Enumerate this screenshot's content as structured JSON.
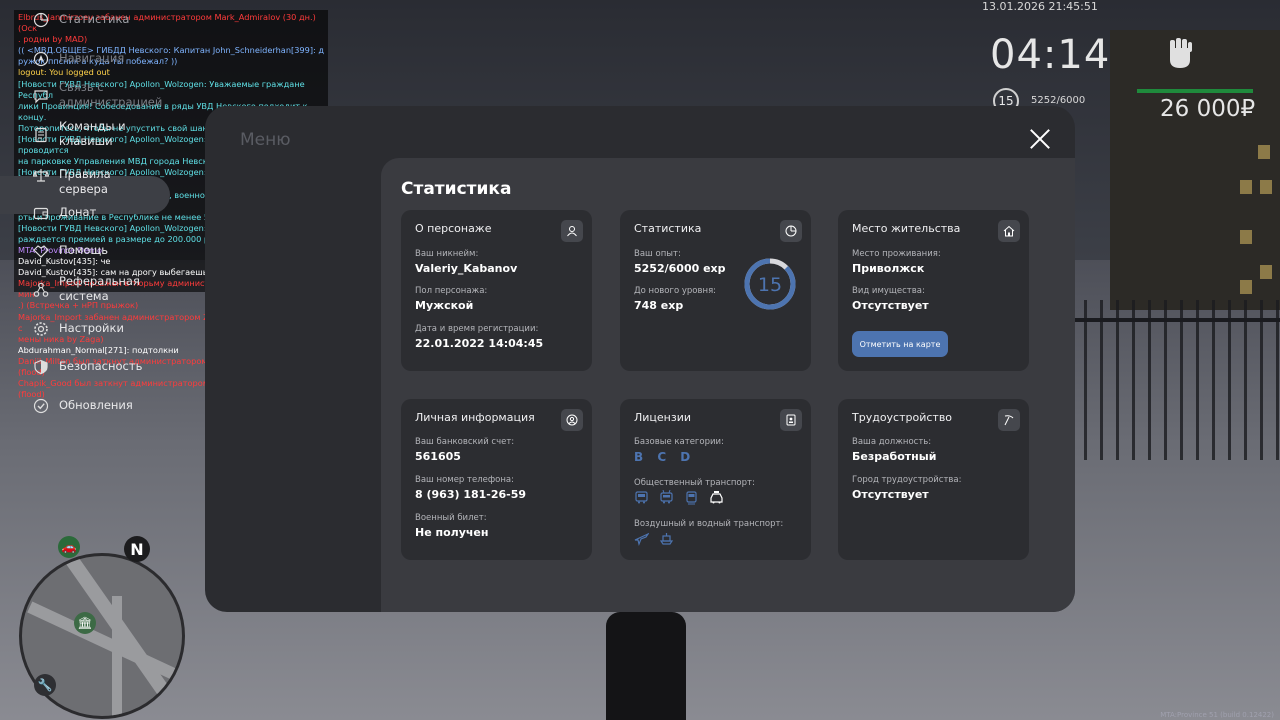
{
  "hud": {
    "datetime": "13.01.2026 21:45:51",
    "time": "04:14",
    "level": "15",
    "exp": "5252/6000",
    "money": "26 000₽",
    "version": "MTA:Province 51 (build 0.12422)"
  },
  "chat": [
    {
      "text": "Elbrus_Janmirzoev забанен администратором Mark_Admiralov (30 дн.) (Оск",
      "color": "#ff3b3b"
    },
    {
      "text": ". родни by MAD)",
      "color": "#ff3b3b"
    },
    {
      "text": "(( <МВД.ОБЩЕЕ> ГИБДД Невского: Капитан John_Schneiderhan[399]: д",
      "color": "#7fb4ff"
    },
    {
      "text": "ружок ппсник а куда ты побежал? ))",
      "color": "#7fb4ff"
    },
    {
      "text": "logout: You logged out",
      "color": "#ffd34a"
    },
    {
      "text": "[Новости ГУВД Невского] Apollon_Wolzogen: Уважаемые граждане Республ",
      "color": "#5fe0e6"
    },
    {
      "text": "лики Провинция! Собеседование в ряды УВД Невского подходит к концу.",
      "color": "#5fe0e6"
    },
    {
      "text": " Поторопитесь, чтобы не упустить свой шанс!",
      "color": "#5fe0e6"
    },
    {
      "text": "[Новости ГУВД Невского] Apollon_Wolzogen: Собеседование проводится",
      "color": "#5fe0e6"
    },
    {
      "text": "на парковке Управления МВД города Невский.",
      "color": "#5fe0e6"
    },
    {
      "text": "[Новости ГУВД Невского] Apollon_Wolzogen: Требования к кандидатам: на",
      "color": "#5fe0e6"
    },
    {
      "text": "личие высшего юридического обр., военного билета, лицензии на а. ка",
      "color": "#5fe0e6"
    },
    {
      "text": "рты и проживание в Республике не менее 5 лет.",
      "color": "#5fe0e6"
    },
    {
      "text": "[Новости ГУВД Невского] Apollon_Wolzogen: Прохождение ЦПП вознаг",
      "color": "#5fe0e6"
    },
    {
      "text": "раждается премией в размере до 200.000 рублей.",
      "color": "#5fe0e6"
    },
    {
      "text": "MTA: Province Demo",
      "color": "#c08cff"
    },
    {
      "text": "David_Kustov[435]: че",
      "color": "#ffffff"
    },
    {
      "text": "David_Kustov[435]: сам на дрогу выбегаешь",
      "color": "#ffffff"
    },
    {
      "text": "Majorka_Import посажен в тюрьму администратором Zagid_Mikado (60 мин",
      "color": "#ff3b3b"
    },
    {
      "text": ".) (Встречка + нРП прыжок)",
      "color": "#ff3b3b"
    },
    {
      "text": "Majorka_Import забанен администратором Zagid_Mikado (1 дн.) (Обход с",
      "color": "#ff3b3b"
    },
    {
      "text": "мены ника by Zaga)",
      "color": "#ff3b3b"
    },
    {
      "text": "Abdurahman_Normal[271]: подтолкни",
      "color": "#ffffff"
    },
    {
      "text": "Daniil_Milton был заткнут администратором Zagid_Mikado (50 мин.) (flood)",
      "color": "#ff3b3b"
    },
    {
      "text": "Chapik_Good был заткнут администратором Zagid_Mikado (50 мин.) (flood)",
      "color": "#ff3b3b"
    }
  ],
  "menu": {
    "ghost_title": "Меню",
    "active_index": 0,
    "items": [
      {
        "label": "Статистика",
        "icon": "pie-chart-icon"
      },
      {
        "label": "Навигация",
        "icon": "navigation-icon"
      },
      {
        "label": "Связь с администрацией",
        "icon": "chat-icon"
      },
      {
        "label": "Команды и клавиши",
        "icon": "document-icon"
      },
      {
        "label": "Правила сервера",
        "icon": "scales-icon"
      },
      {
        "label": "Донат",
        "icon": "wallet-icon"
      },
      {
        "label": "Помощь",
        "icon": "handshake-icon"
      },
      {
        "label": "Реферальная система",
        "icon": "referral-icon"
      },
      {
        "label": "Настройки",
        "icon": "gear-icon"
      },
      {
        "label": "Безопасность",
        "icon": "shield-icon"
      },
      {
        "label": "Обновления",
        "icon": "update-icon"
      }
    ]
  },
  "stats": {
    "title": "Статистика",
    "about": {
      "title": "О персонаже",
      "nick_label": "Ваш никнейм:",
      "nick": "Valeriy_Kabanov",
      "gender_label": "Пол персонажа:",
      "gender": "Мужской",
      "reg_label": "Дата и время регистрации:",
      "reg": "22.01.2022 14:04:45"
    },
    "progress": {
      "title": "Статистика",
      "exp_label": "Ваш опыт:",
      "exp": "5252/6000 exp",
      "next_label": "До нового уровня:",
      "next": "748 exp",
      "level": "15",
      "fraction": 0.875
    },
    "residence": {
      "title": "Место жительства",
      "place_label": "Место проживания:",
      "place": "Приволжск",
      "property_label": "Вид имущества:",
      "property": "Отсутствует",
      "map_button": "Отметить на карте"
    },
    "personal": {
      "title": "Личная информация",
      "bank_label": "Ваш банковский счет:",
      "bank": "561605",
      "phone_label": "Ваш номер телефона:",
      "phone": "8 (963) 181-26-59",
      "military_label": "Военный билет:",
      "military": "Не получен"
    },
    "licenses": {
      "title": "Лицензии",
      "base_label": "Базовые категории:",
      "base": "B C D",
      "public_label": "Общественный транспорт:",
      "air_label": "Воздушный и водный транспорт:"
    },
    "job": {
      "title": "Трудоустройство",
      "position_label": "Ваша должность:",
      "position": "Безработный",
      "city_label": "Город трудоустройства:",
      "city": "Отсутствует"
    }
  }
}
